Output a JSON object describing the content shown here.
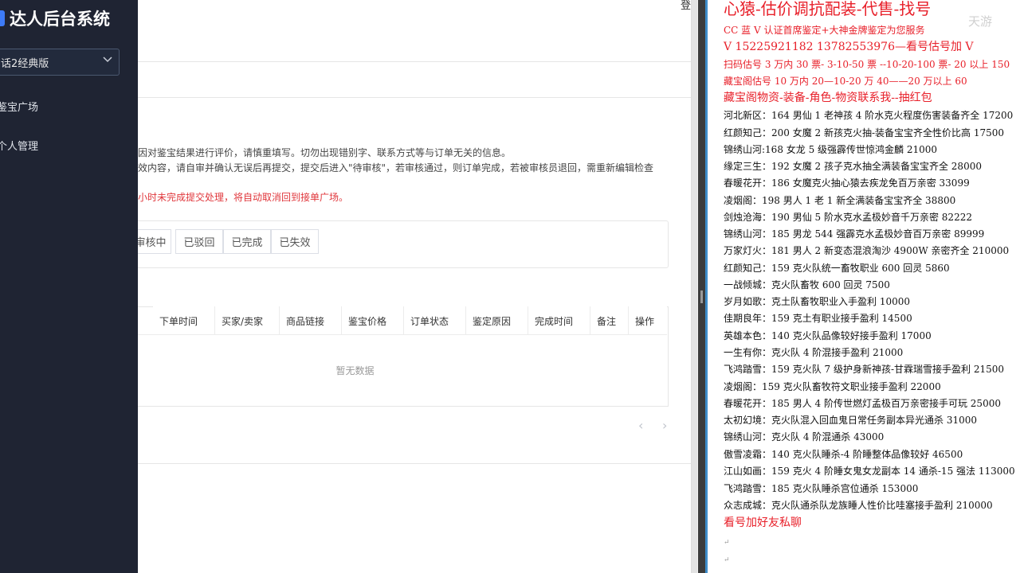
{
  "sidebar": {
    "brand": "达人后台系统",
    "game_select": "话2经典版",
    "menu": [
      {
        "label": "鉴宝广场"
      },
      {
        "label": "个人管理"
      }
    ]
  },
  "header": {
    "top_right": "登"
  },
  "notices": {
    "line1": "因对鉴宝结果进行评价，请慎重填写。切勿出现错别字、联系方式等与订单无关的信息。",
    "line2": "效内容，请自审并确认无误后再提交，提交后进入\"待审核\"，若审核通过，则订单完成，若被审核员退回，需重新编辑检查",
    "line3": "小时未完成提交处理，将自动取消回到接单广场。"
  },
  "tabs": [
    {
      "label": "审核中"
    },
    {
      "label": "已驳回"
    },
    {
      "label": "已完成"
    },
    {
      "label": "已失效"
    }
  ],
  "table": {
    "columns": [
      "下单时间",
      "买家/卖家",
      "商品链接",
      "鉴宝价格",
      "订单状态",
      "鉴定原因",
      "完成时间",
      "备注",
      "操作"
    ],
    "empty_text": "暂无数据"
  },
  "pager": {
    "prev": "‹",
    "next": "›"
  },
  "notes": {
    "watermark": "天游",
    "lines": [
      {
        "text": "心猿-估价调抗配装-代售-找号",
        "style": "red big"
      },
      {
        "text": "CC 蓝 V 认证首席鉴定+大神金牌鉴定为您服务",
        "style": "red"
      },
      {
        "text": "V 15225921182      13782553976—看号估号加 V",
        "style": "red med"
      },
      {
        "text": "扫码估号 3 万内 30 票- 3-10-50 票  --10-20-100 票- 20 以上 150",
        "style": "red"
      },
      {
        "text": "藏宝阁估号 10 万内 20—10-20 万 40——20 万以上 60",
        "style": "red"
      },
      {
        "text": "藏宝阁物资-装备-角色-物资联系我--抽红包",
        "style": "red med"
      },
      {
        "text": "河北新区：164 男仙 1 老神孩 4 阶水克火程度伤害装备齐全 17200",
        "style": ""
      },
      {
        "text": "红颜知己：200 女魔 2 新孩克火抽-装备宝宝齐全性价比高 17500",
        "style": ""
      },
      {
        "text": "锦绣山河:168 女龙 5 级强霹传世惊鸿金麟 21000",
        "style": ""
      },
      {
        "text": "缘定三生：192 女魔 2 孩子克水抽全满装备宝宝齐全 28000",
        "style": ""
      },
      {
        "text": "春暖花开：186 女魔克火抽心猿去疾龙免百万亲密 33099",
        "style": ""
      },
      {
        "text": "凌烟阁：198 男人 1 老 1 新全满装备宝宝齐全 38800",
        "style": ""
      },
      {
        "text": "剑烛沧海：190 男仙 5 阶水克水孟极妙音千万亲密 82222",
        "style": ""
      },
      {
        "text": "锦绣山河：185 男龙 544 强霹克水孟极妙音百万亲密 89999",
        "style": ""
      },
      {
        "text": "万家灯火：181 男人 2 新变态混浪淘沙 4900W 亲密齐全 210000",
        "style": ""
      },
      {
        "text": "红颜知己：159 克火队统一畜牧职业 600 回灵 5860",
        "style": ""
      },
      {
        "text": "一战倾城：克火队畜牧 600 回灵 7500",
        "style": ""
      },
      {
        "text": "岁月如歌：克土队畜牧职业入手盈利 10000",
        "style": ""
      },
      {
        "text": "佳期良年：159 克土有职业接手盈利 14500",
        "style": ""
      },
      {
        "text": "英雄本色：140 克火队品像较好接手盈利 17000",
        "style": ""
      },
      {
        "text": "一生有你：克火队 4 阶混接手盈利 21000",
        "style": ""
      },
      {
        "text": "飞鸿踏雪：159 克火队 7 级护身新神孩-甘霖瑞雪接手盈利 21500",
        "style": ""
      },
      {
        "text": "凌烟阁：159 克火队畜牧符文职业接手盈利 22000",
        "style": ""
      },
      {
        "text": "春暖花开：185 男人 4 阶传世燃灯孟极百万亲密接手可玩 25000",
        "style": ""
      },
      {
        "text": "太初幻境：克火队混入回血鬼日常任务副本异光通杀 31000",
        "style": ""
      },
      {
        "text": "锦绣山河：克火队 4 阶混通杀 43000",
        "style": ""
      },
      {
        "text": "傲雪凌霜：140 克火队睡杀-4 阶睡整体品像较好 46500",
        "style": ""
      },
      {
        "text": "江山如画：159 克火 4 阶睡女鬼女龙副本 14 通杀-15 强法 113000",
        "style": ""
      },
      {
        "text": "飞鸿踏雪：185 克火队睡杀宫位通杀 153000",
        "style": ""
      },
      {
        "text": "众志成城：克火队通杀队龙族睡人性价比哇塞接手盈利 210000",
        "style": ""
      },
      {
        "text": "看号加好友私聊",
        "style": "red med"
      }
    ]
  }
}
